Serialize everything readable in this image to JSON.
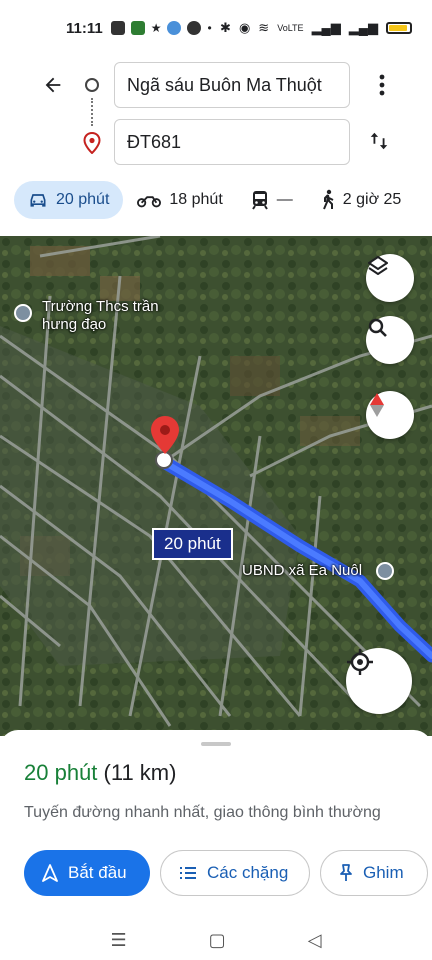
{
  "status_bar": {
    "time": "11:11",
    "apps": [
      "Zalo",
      "zalo-app",
      "star",
      "map",
      "circle",
      "dot"
    ],
    "network": "VoLTE"
  },
  "directions": {
    "origin": "Ngã sáu Buôn Ma Thuột",
    "destination": "ĐT681",
    "modes": [
      {
        "icon": "car-icon",
        "label": "20 phút",
        "active": true
      },
      {
        "icon": "motorbike-icon",
        "label": "18 phút",
        "active": false
      },
      {
        "icon": "transit-icon",
        "label": "—",
        "active": false
      },
      {
        "icon": "walk-icon",
        "label": "2 giờ 25",
        "active": false
      }
    ]
  },
  "map": {
    "route_label": "20 phút",
    "pois": [
      {
        "name": "Trường Thcs trần hưng đạo"
      },
      {
        "name": "UBND xã Ea Nuôl"
      }
    ],
    "route_color": "#2f5bea"
  },
  "sheet": {
    "duration": "20 phút",
    "distance": "(11 km)",
    "description": "Tuyến đường nhanh nhất, giao thông bình thường",
    "start_label": "Bắt đầu",
    "steps_label": "Các chặng",
    "pin_label": "Ghim"
  }
}
